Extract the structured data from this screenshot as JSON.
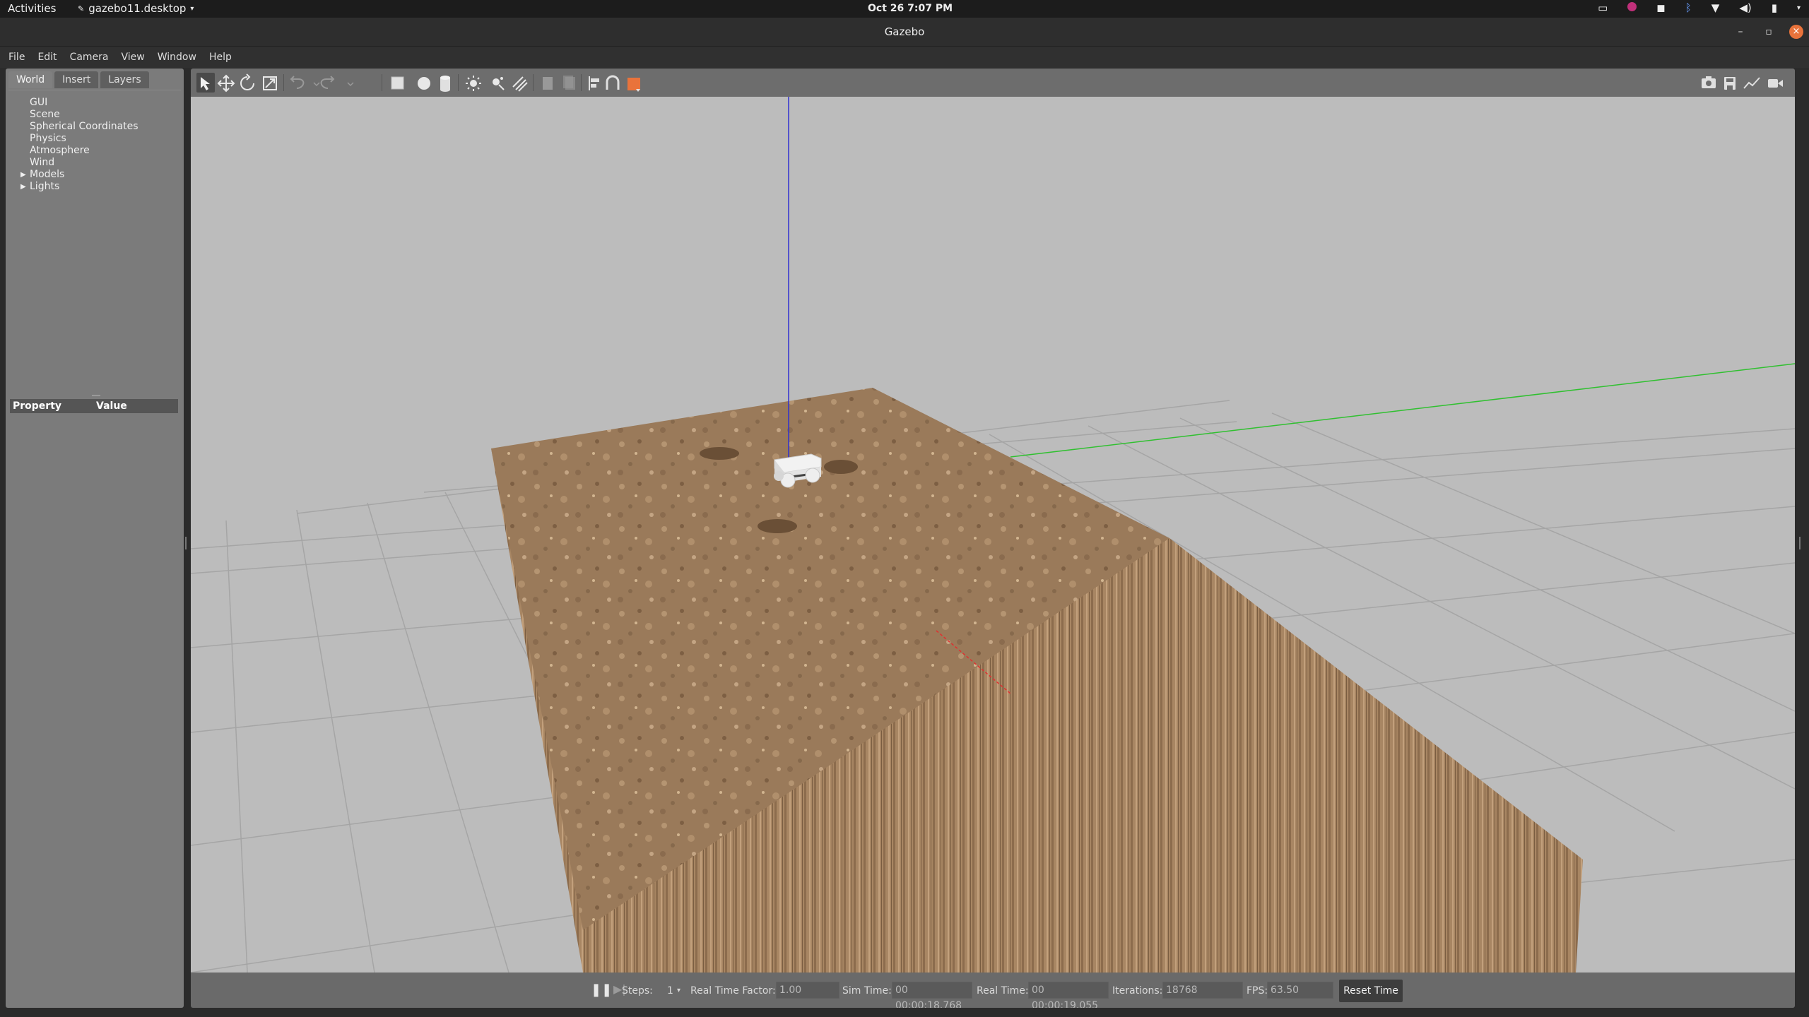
{
  "topbar": {
    "activities": "Activities",
    "app_name": "gazebo11.desktop",
    "clock": "Oct 26  7:07 PM",
    "tray_icons": [
      "display-icon",
      "record-icon",
      "game-icon",
      "bluetooth-icon",
      "wifi-icon",
      "volume-icon",
      "battery-icon",
      "chevron-down-icon"
    ]
  },
  "window": {
    "title": "Gazebo",
    "controls": {
      "minimize": "–",
      "maximize": "▫",
      "close": "×"
    }
  },
  "menubar": [
    "File",
    "Edit",
    "Camera",
    "View",
    "Window",
    "Help"
  ],
  "left_panel": {
    "tabs": [
      "World",
      "Insert",
      "Layers"
    ],
    "active_tab": "World",
    "tree": [
      {
        "label": "GUI",
        "expandable": false
      },
      {
        "label": "Scene",
        "expandable": false
      },
      {
        "label": "Spherical Coordinates",
        "expandable": false
      },
      {
        "label": "Physics",
        "expandable": false
      },
      {
        "label": "Atmosphere",
        "expandable": false
      },
      {
        "label": "Wind",
        "expandable": false
      },
      {
        "label": "Models",
        "expandable": true
      },
      {
        "label": "Lights",
        "expandable": true
      }
    ],
    "property_header": {
      "property": "Property",
      "value": "Value"
    }
  },
  "toolbar": {
    "tools": [
      "select-icon",
      "translate-icon",
      "rotate-icon",
      "scale-icon",
      "undo-icon",
      "redo-icon",
      "box-icon",
      "sphere-icon",
      "cylinder-icon",
      "point-light-icon",
      "spot-light-icon",
      "directional-light-icon",
      "copy-icon",
      "paste-icon",
      "align-icon",
      "snap-icon",
      "view-angle-icon"
    ],
    "right_tools": [
      "screenshot-icon",
      "log-icon",
      "plot-icon",
      "record-video-icon"
    ]
  },
  "bottom_bar": {
    "steps_label": "Steps:",
    "steps_value": "1",
    "rtf_label": "Real Time Factor:",
    "rtf_value": "1.00",
    "sim_time_label": "Sim Time:",
    "sim_time_value": "00 00:00:18.768",
    "real_time_label": "Real Time:",
    "real_time_value": "00 00:00:19.055",
    "iterations_label": "Iterations:",
    "iterations_value": "18768",
    "fps_label": "FPS:",
    "fps_value": "63.50",
    "reset_label": "Reset Time"
  },
  "colors": {
    "ground": "#bcbcbc",
    "grid": "#9a9a9a",
    "terrain_top": "#9b7b5b",
    "terrain_side": "#a88663",
    "axis_x": "#e03030",
    "axis_y": "#30c030",
    "axis_z": "#3030d0",
    "accent": "#e9733b"
  }
}
